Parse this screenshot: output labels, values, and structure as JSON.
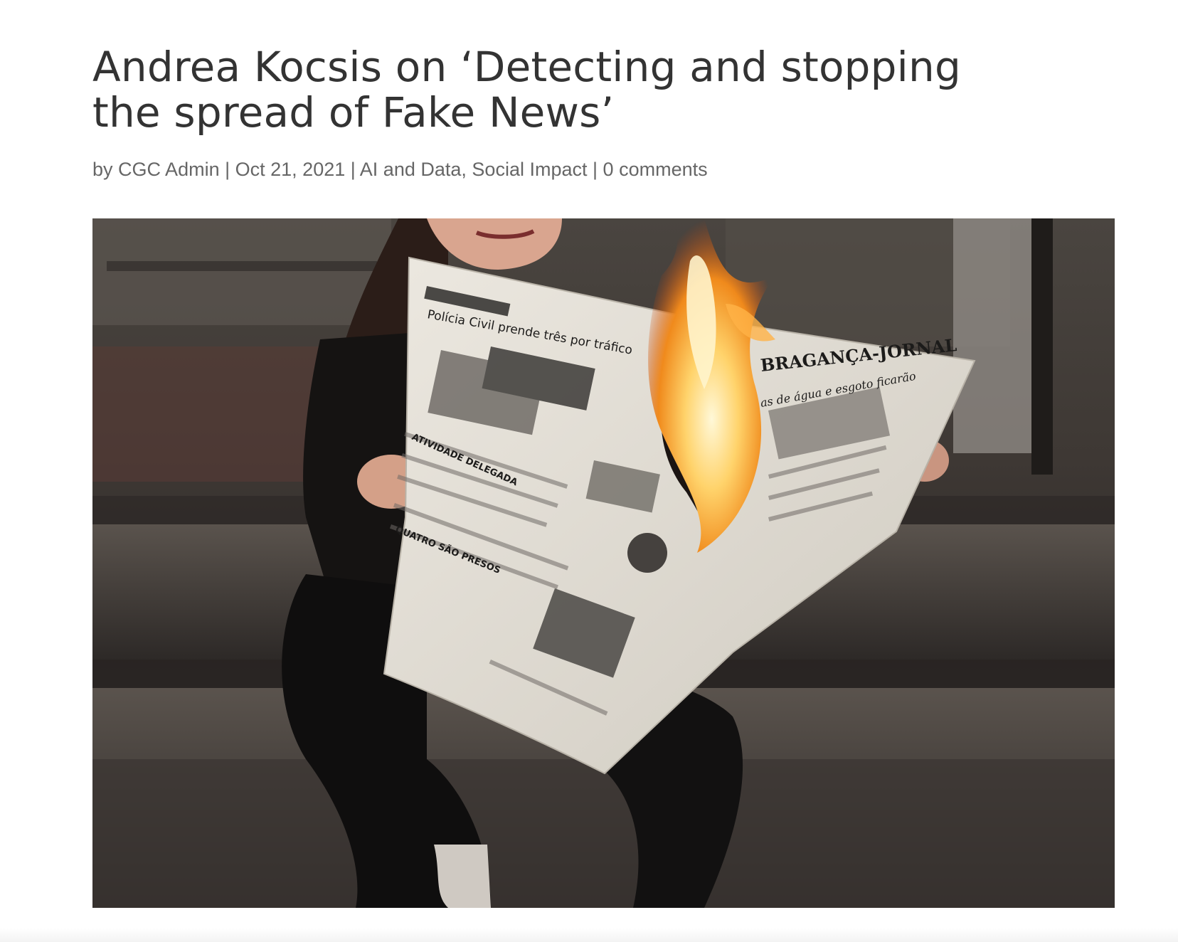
{
  "post": {
    "title_line1": "Andrea Kocsis on ‘Detecting and stopping",
    "title_line2": "the spread of Fake News’",
    "meta": {
      "by_prefix": "by",
      "author": "CGC Admin",
      "separator": "|",
      "date": "Oct 21, 2021",
      "category_1": "AI and Data",
      "category_comma": ",",
      "category_2": "Social Impact",
      "comments": "0 comments"
    },
    "featured_image": {
      "alt": "Woman sitting on concrete steps reading a burning newspaper",
      "newspaper_headline_left": "Polícia Civil prende três por tráfico",
      "newspaper_masthead": "BRAGANÇA-JORNAL",
      "newspaper_section_1": "ATIVIDADE DELEGADA",
      "newspaper_section_2": "QUATRO SÃO PRESOS",
      "newspaper_headline_right": "as de água e esgoto ficarão"
    }
  },
  "colors": {
    "title_text": "#333333",
    "meta_text": "#666666",
    "background": "#ffffff"
  }
}
